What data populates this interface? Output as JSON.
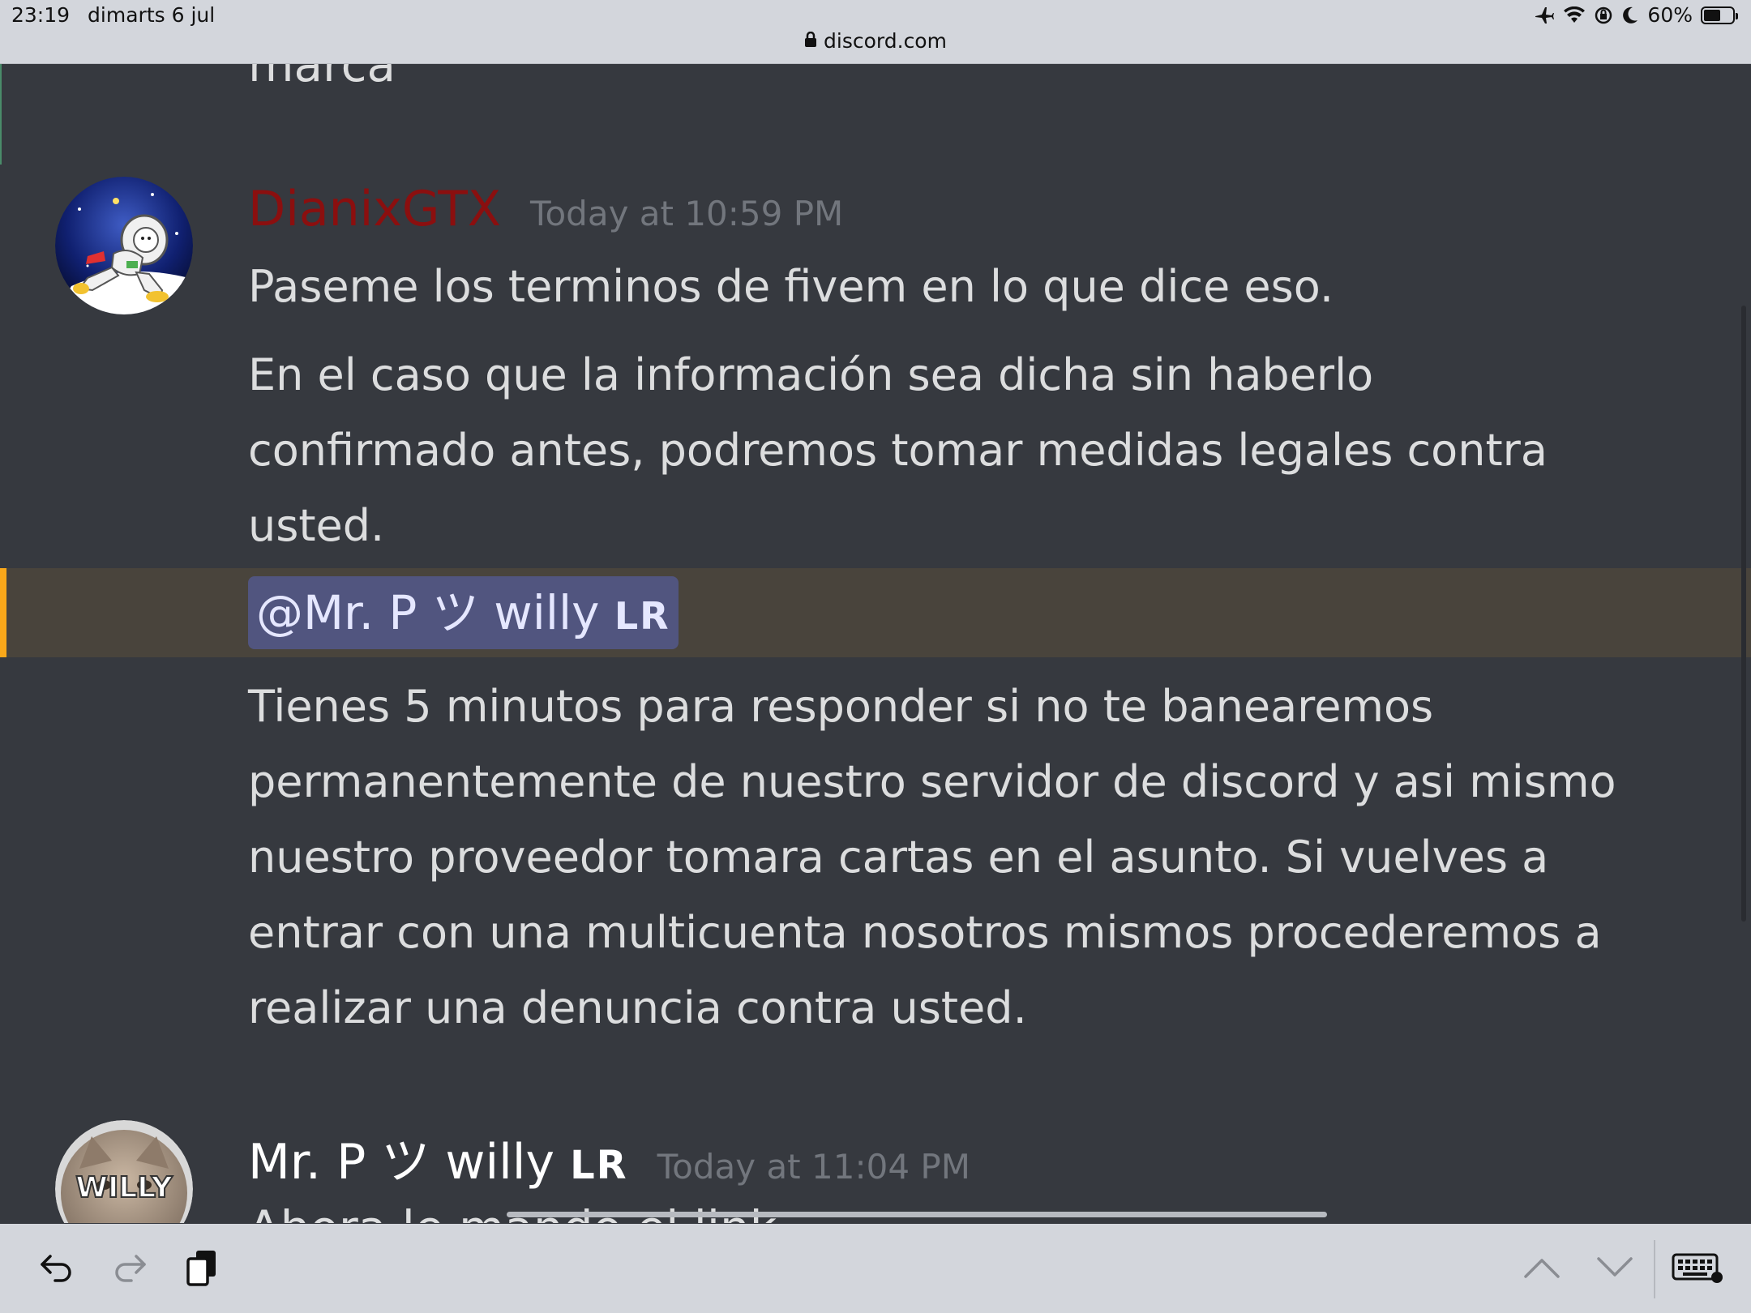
{
  "status": {
    "time": "23:19",
    "date": "dimarts 6 jul",
    "battery": "60%"
  },
  "browser": {
    "url": "discord.com"
  },
  "previous": {
    "text": "marca"
  },
  "messages": [
    {
      "username": "DianixGTX",
      "timestamp": "Today at 10:59 PM",
      "lines": [
        "Paseme los terminos de fivem en lo que dice eso.",
        "En el caso que la información sea dicha sin haberlo confirmado antes, podremos tomar medidas legales contra usted."
      ],
      "mention": {
        "text": "@Mr. P  ツ willy",
        "tag": "LR"
      },
      "after_mention": "Tienes 5 minutos para responder si no te banearemos permanentemente de nuestro servidor de discord y asi mismo nuestro proveedor tomara cartas en el asunto. Si vuelves a entrar con una multicuenta nosotros mismos procederemos a realizar una denuncia contra usted."
    },
    {
      "username": "Mr. P  ツ willy",
      "tag": "LR",
      "timestamp": "Today at 11:04 PM",
      "avatar_text": "WILLY",
      "partial_text": "Ahora le mando el link"
    }
  ],
  "colors": {
    "background": "#36393f",
    "mention_highlight": "#49443c",
    "mention_bar": "#faa81a",
    "mention_chip": "#51557f",
    "username_red": "#8b0f0f"
  },
  "icons": [
    "lock-icon",
    "airplane-icon",
    "wifi-icon",
    "orientation-lock-icon",
    "moon-icon",
    "battery-icon",
    "undo-icon",
    "redo-icon",
    "paste-icon",
    "chevron-up-icon",
    "chevron-down-icon",
    "keyboard-icon"
  ]
}
